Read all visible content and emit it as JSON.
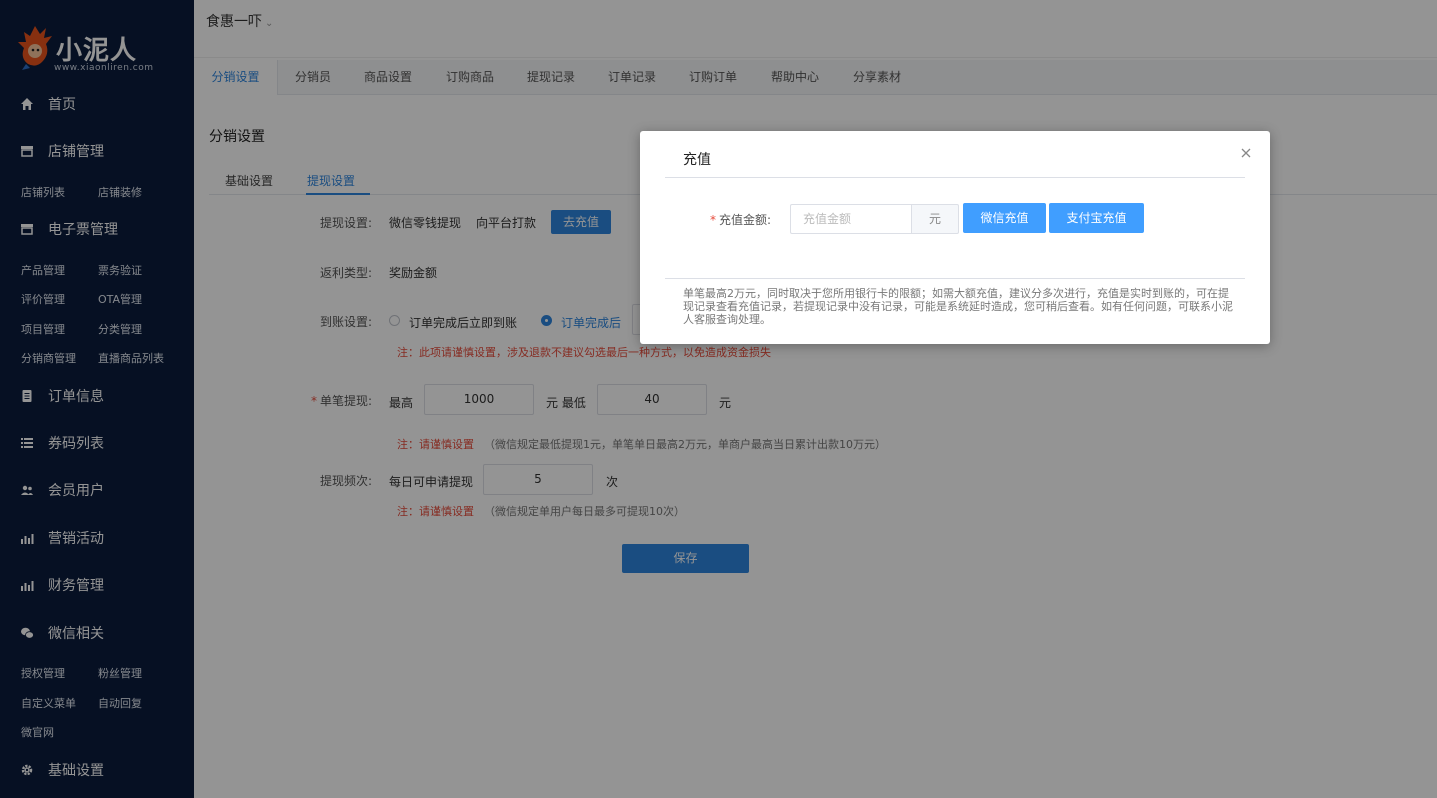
{
  "brand": {
    "name": "小泥人",
    "url": "www.xiaonliren.com"
  },
  "sidebar": {
    "groups": [
      {
        "label": "首页",
        "icon": "home-icon"
      },
      {
        "label": "店铺管理",
        "icon": "store-icon",
        "items": [
          "店铺列表",
          "店铺装修"
        ]
      },
      {
        "label": "电子票管理",
        "icon": "ticket-icon",
        "items": [
          "产品管理",
          "票务验证",
          "评价管理",
          "OTA管理",
          "项目管理",
          "分类管理",
          "分销商管理",
          "直播商品列表"
        ]
      },
      {
        "label": "订单信息",
        "icon": "clipboard-icon"
      },
      {
        "label": "券码列表",
        "icon": "list-icon"
      },
      {
        "label": "会员用户",
        "icon": "users-icon"
      },
      {
        "label": "营销活动",
        "icon": "chart-icon"
      },
      {
        "label": "财务管理",
        "icon": "chart-icon"
      },
      {
        "label": "微信相关",
        "icon": "wechat-icon",
        "items": [
          "授权管理",
          "粉丝管理",
          "自定义菜单",
          "自动回复",
          "微官网"
        ]
      },
      {
        "label": "基础设置",
        "icon": "gear-icon"
      }
    ]
  },
  "header": {
    "shop_name": "食惠一吓"
  },
  "tabs": [
    "分销设置",
    "分销员",
    "商品设置",
    "订购商品",
    "提现记录",
    "订单记录",
    "订购订单",
    "帮助中心",
    "分享素材"
  ],
  "page": {
    "title": "分销设置",
    "subtabs": [
      "基础设置",
      "提现设置"
    ],
    "withdraw": {
      "label": "提现设置:",
      "opt1": "微信零钱提现",
      "opt2": "向平台打款",
      "recharge_btn": "去充值"
    },
    "rebate": {
      "label": "返利类型:",
      "value": "奖励金额"
    },
    "arrival": {
      "label": "到账设置:",
      "opt1": "订单完成后立即到账",
      "opt2": "订单完成后",
      "note": "注：此项请谨慎设置，涉及退款不建议勾选最后一种方式，以免造成资金损失"
    },
    "single": {
      "label": "单笔提现:",
      "max_label": "最高",
      "max_value": "1000",
      "mid_label": "元 最低",
      "min_value": "40",
      "unit": "元",
      "note_red": "注：请谨慎设置",
      "note_grey": "（微信规定最低提现1元，单笔单日最高2万元，单商户最高当日累计出款10万元）"
    },
    "frequency": {
      "label": "提现频次:",
      "prefix": "每日可申请提现",
      "value": "5",
      "unit": "次",
      "note_red": "注：请谨慎设置",
      "note_grey": "（微信规定单用户每日最多可提现10次）"
    },
    "save_btn": "保存"
  },
  "modal": {
    "title": "充值",
    "amount_label": "充值金额:",
    "amount_placeholder": "充值金额",
    "unit": "元",
    "wechat_btn": "微信充值",
    "alipay_btn": "支付宝充值",
    "tip": "单笔最高2万元，同时取决于您所用银行卡的限额；如需大额充值，建议分多次进行，充值是实时到账的，可在提现记录查看充值记录，若提现记录中没有记录，可能是系统延时造成，您可稍后查看。如有任何问题，可联系小泥人客服查询处理。"
  },
  "colors": {
    "sidebar_bg": "#0b1d3d",
    "accent": "#2e86de",
    "modal_button": "#409eff",
    "warning": "#e74c3c"
  }
}
